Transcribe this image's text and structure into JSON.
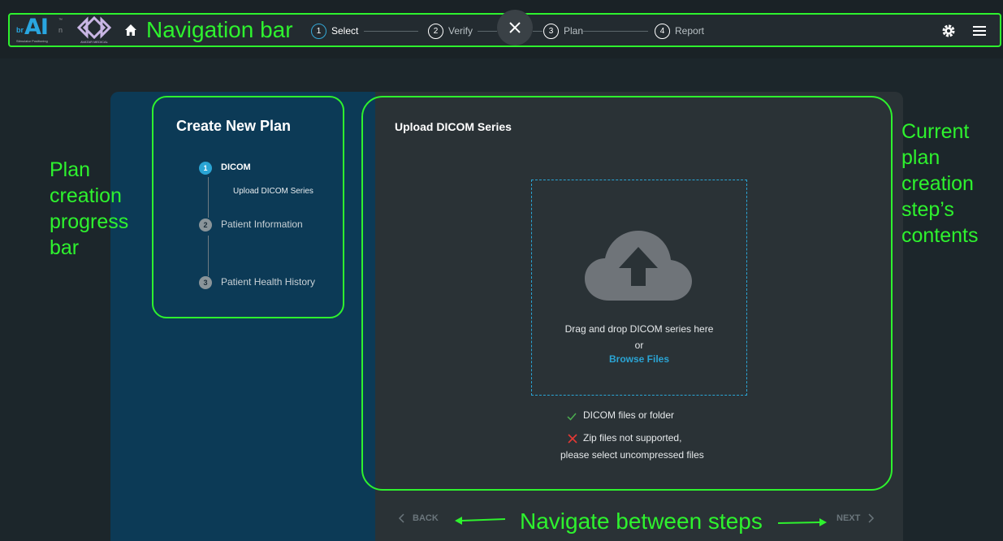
{
  "navbar": {
    "brand_pre": "br",
    "brand_main": "AI",
    "brand_suffix": "n",
    "brand_tm": "™",
    "brand_tagline": "Stimulator Positioning",
    "partner_caption": "AVATAR MEDICAL",
    "steps": [
      {
        "num": "1",
        "label": "Select"
      },
      {
        "num": "2",
        "label": "Verify"
      },
      {
        "num": "3",
        "label": "Plan"
      },
      {
        "num": "4",
        "label": "Report"
      }
    ],
    "icons": {
      "home": "home-icon",
      "close": "close-icon",
      "settings": "gear-icon",
      "menu": "hamburger-menu-icon"
    }
  },
  "annotations": {
    "navigation_bar": "Navigation bar",
    "progress_bar": "Plan creation progress bar",
    "step_contents": "Current plan creation step’s contents",
    "navigate_steps": "Navigate between steps"
  },
  "plan_progress": {
    "title": "Create New Plan",
    "steps": [
      {
        "num": "1",
        "label": "DICOM",
        "sub": "Upload DICOM Series",
        "state": "active"
      },
      {
        "num": "2",
        "label": "Patient Information",
        "state": "todo"
      },
      {
        "num": "3",
        "label": "Patient Health History",
        "state": "todo"
      }
    ]
  },
  "upload": {
    "title": "Upload DICOM Series",
    "drop_line1": "Drag and drop DICOM series here",
    "drop_or": "or",
    "browse_label": "Browse Files",
    "requirements": {
      "ok_text": "DICOM files or folder",
      "bad_text_1": "Zip files not supported,",
      "bad_text_2": "please select uncompressed files"
    }
  },
  "footer_nav": {
    "back": "BACK",
    "next": "NEXT"
  },
  "colors": {
    "accent": "#2aa4d4",
    "annotation": "#2ef22e",
    "sidebar": "#0c3a56",
    "panel": "#2a3236"
  }
}
